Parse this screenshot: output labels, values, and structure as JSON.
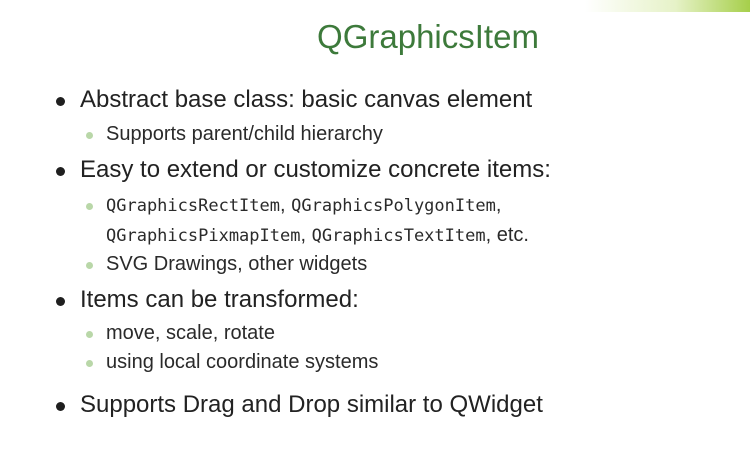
{
  "slide": {
    "title": "QGraphicsItem",
    "accent_color": "#a6cf4a",
    "title_color": "#3d7a3b",
    "bullets": [
      {
        "level": 1,
        "text": "Abstract base class: basic canvas element"
      },
      {
        "level": 2,
        "text": "Supports parent/child hierarchy"
      },
      {
        "level": 1,
        "text": "Easy to extend or customize concrete items:"
      },
      {
        "level": 2,
        "line1": {
          "code_a": "QGraphicsRectItem",
          "sep_a": ", ",
          "code_b": "QGraphicsPolygonItem",
          "sep_b": ","
        },
        "line2": {
          "code_a": "QGraphicsPixmapItem",
          "sep_a": ", ",
          "code_b": "QGraphicsTextItem",
          "tail": ", etc."
        }
      },
      {
        "level": 2,
        "text": "SVG Drawings, other widgets"
      },
      {
        "level": 1,
        "text": "Items can be transformed:"
      },
      {
        "level": 2,
        "text": "move, scale, rotate"
      },
      {
        "level": 2,
        "text": "using local coordinate systems"
      },
      {
        "level": 1,
        "text": "Supports Drag and Drop similar to QWidget"
      }
    ]
  }
}
